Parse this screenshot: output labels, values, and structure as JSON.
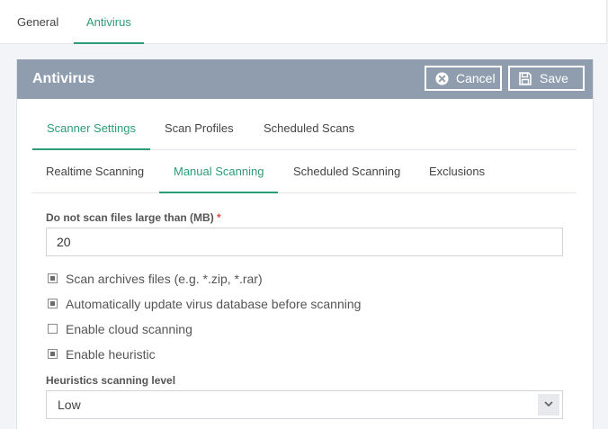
{
  "top_tabs": [
    {
      "label": "General",
      "active": false
    },
    {
      "label": "Antivirus",
      "active": true
    }
  ],
  "panel": {
    "title": "Antivirus",
    "cancel_label": "Cancel",
    "save_label": "Save"
  },
  "tabs_row1": [
    {
      "label": "Scanner Settings",
      "active": true
    },
    {
      "label": "Scan Profiles",
      "active": false
    },
    {
      "label": "Scheduled Scans",
      "active": false
    }
  ],
  "tabs_row2": [
    {
      "label": "Realtime Scanning",
      "active": false
    },
    {
      "label": "Manual Scanning",
      "active": true
    },
    {
      "label": "Scheduled Scanning",
      "active": false
    },
    {
      "label": "Exclusions",
      "active": false
    }
  ],
  "max_size": {
    "label": "Do not scan files large than (MB)",
    "required_mark": "*",
    "value": "20"
  },
  "options": [
    {
      "label": "Scan archives files (e.g. *.zip, *.rar)",
      "checked": true
    },
    {
      "label": "Automatically update virus database before scanning",
      "checked": true
    },
    {
      "label": "Enable cloud scanning",
      "checked": false
    },
    {
      "label": "Enable heuristic",
      "checked": true
    }
  ],
  "heuristics": {
    "label": "Heuristics scanning level",
    "selected": "Low"
  },
  "colors": {
    "accent": "#2e9b79",
    "header_bg": "#8f9daf",
    "required": "#e04a4a"
  }
}
